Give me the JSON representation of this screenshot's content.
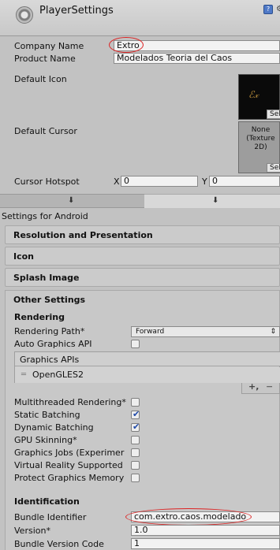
{
  "header": {
    "title": "PlayerSettings"
  },
  "fields": {
    "company_name": {
      "label": "Company Name",
      "value": "Extro"
    },
    "product_name": {
      "label": "Product Name",
      "value": "Modelados Teoria del Caos"
    },
    "default_icon": {
      "label": "Default Icon",
      "select_label": "Selec"
    },
    "default_cursor": {
      "label": "Default Cursor",
      "none_text": "None\n(Texture\n2D)",
      "select_label": "Selec"
    },
    "cursor_hotspot": {
      "label": "Cursor Hotspot",
      "x_label": "X",
      "x_value": "0",
      "y_label": "Y",
      "y_value": "0"
    }
  },
  "settings_for": "Settings for Android",
  "sections": [
    {
      "label": "Resolution and Presentation"
    },
    {
      "label": "Icon"
    },
    {
      "label": "Splash Image"
    },
    {
      "label": "Other Settings"
    }
  ],
  "rendering": {
    "heading": "Rendering",
    "rendering_path": {
      "label": "Rendering Path*",
      "value": "Forward"
    },
    "auto_graphics_api": {
      "label": "Auto Graphics API",
      "checked": false
    },
    "graphics_apis": {
      "header": "Graphics APIs",
      "items": [
        "OpenGLES2"
      ]
    },
    "toggles": [
      {
        "label": "Multithreaded Rendering*",
        "checked": false
      },
      {
        "label": "Static Batching",
        "checked": true
      },
      {
        "label": "Dynamic Batching",
        "checked": true
      },
      {
        "label": "GPU Skinning*",
        "checked": false
      },
      {
        "label": "Graphics Jobs (Experimer",
        "checked": false
      },
      {
        "label": "Virtual Reality Supported",
        "checked": false
      },
      {
        "label": "Protect Graphics Memory",
        "checked": false
      }
    ]
  },
  "identification": {
    "heading": "Identification",
    "bundle_identifier": {
      "label": "Bundle Identifier",
      "value": "com.extro.caos.modelado"
    },
    "version": {
      "label": "Version*",
      "value": "1.0"
    },
    "bundle_version_code": {
      "label": "Bundle Version Code",
      "value": "1"
    }
  },
  "colors": {
    "annotation": "#dd2222",
    "check": "#1f49a8"
  },
  "icons": {
    "header": "gear-icon",
    "help": "help-icon",
    "tab_left": "computer-icon",
    "tab_right": "android-icon"
  }
}
